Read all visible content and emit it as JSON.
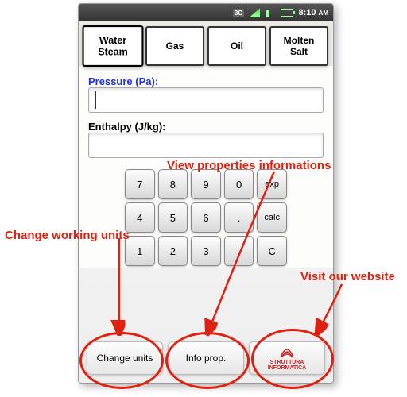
{
  "status": {
    "time": "8:10",
    "ampm": "AM",
    "net": "3G"
  },
  "tabs": [
    {
      "label": "Water\nSteam"
    },
    {
      "label": "Gas"
    },
    {
      "label": "Oil"
    },
    {
      "label": "Molten\nSalt"
    }
  ],
  "fields": {
    "pressure_label": "Pressure (Pa):",
    "pressure_value": "",
    "enthalpy_label": "Enthalpy (J/kg):",
    "enthalpy_value": ""
  },
  "keypad": [
    [
      "7",
      "8",
      "9",
      "0",
      "exp"
    ],
    [
      "4",
      "5",
      "6",
      ".",
      "calc"
    ],
    [
      "1",
      "2",
      "3",
      "-",
      "C"
    ]
  ],
  "bottom": {
    "change_units": "Change units",
    "info_prop": "Info prop.",
    "brand1": "STRUTTURA",
    "brand2": "INFORMATICA"
  },
  "annotations": {
    "view_props": "View properties informations",
    "change_units": "Change working units",
    "visit_site": "Visit our website"
  }
}
